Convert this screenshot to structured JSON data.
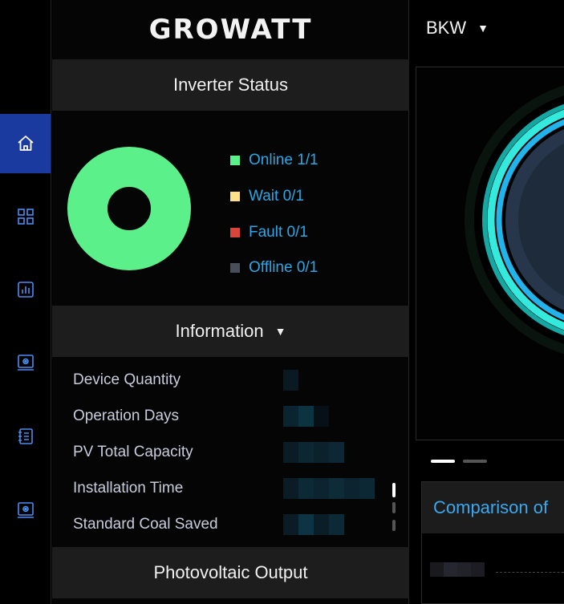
{
  "rail": {
    "items": [
      {
        "icon": "home-icon",
        "active": true
      },
      {
        "icon": "grid-icon",
        "active": false
      },
      {
        "icon": "chart-icon",
        "active": false
      },
      {
        "icon": "device-settings-icon",
        "active": false
      },
      {
        "icon": "notebook-icon",
        "active": false
      },
      {
        "icon": "device-settings-icon",
        "active": false
      }
    ]
  },
  "brand": "GROWATT",
  "inverter_status": {
    "title": "Inverter Status",
    "legend": [
      {
        "label": "Online 1/1",
        "color": "#5cf08a",
        "count": 1
      },
      {
        "label": "Wait 0/1",
        "color": "#ffe08a",
        "count": 0
      },
      {
        "label": "Fault 0/1",
        "color": "#d9453a",
        "count": 0
      },
      {
        "label": "Offline 0/1",
        "color": "#4a4e5a",
        "count": 0
      }
    ]
  },
  "information": {
    "title": "Information",
    "rows": [
      {
        "label": "Device Quantity"
      },
      {
        "label": "Operation Days"
      },
      {
        "label": "PV Total Capacity"
      },
      {
        "label": "Installation Time"
      },
      {
        "label": "Standard Coal Saved"
      }
    ]
  },
  "photovoltaic": {
    "title": "Photovoltaic Output"
  },
  "plant": {
    "name": "BKW"
  },
  "comparison": {
    "title": "Comparison of"
  },
  "colors": {
    "accent_blue": "#28a8e8",
    "rail_active": "#1a3aa0",
    "ring_cyan": "#2ee6d6"
  }
}
